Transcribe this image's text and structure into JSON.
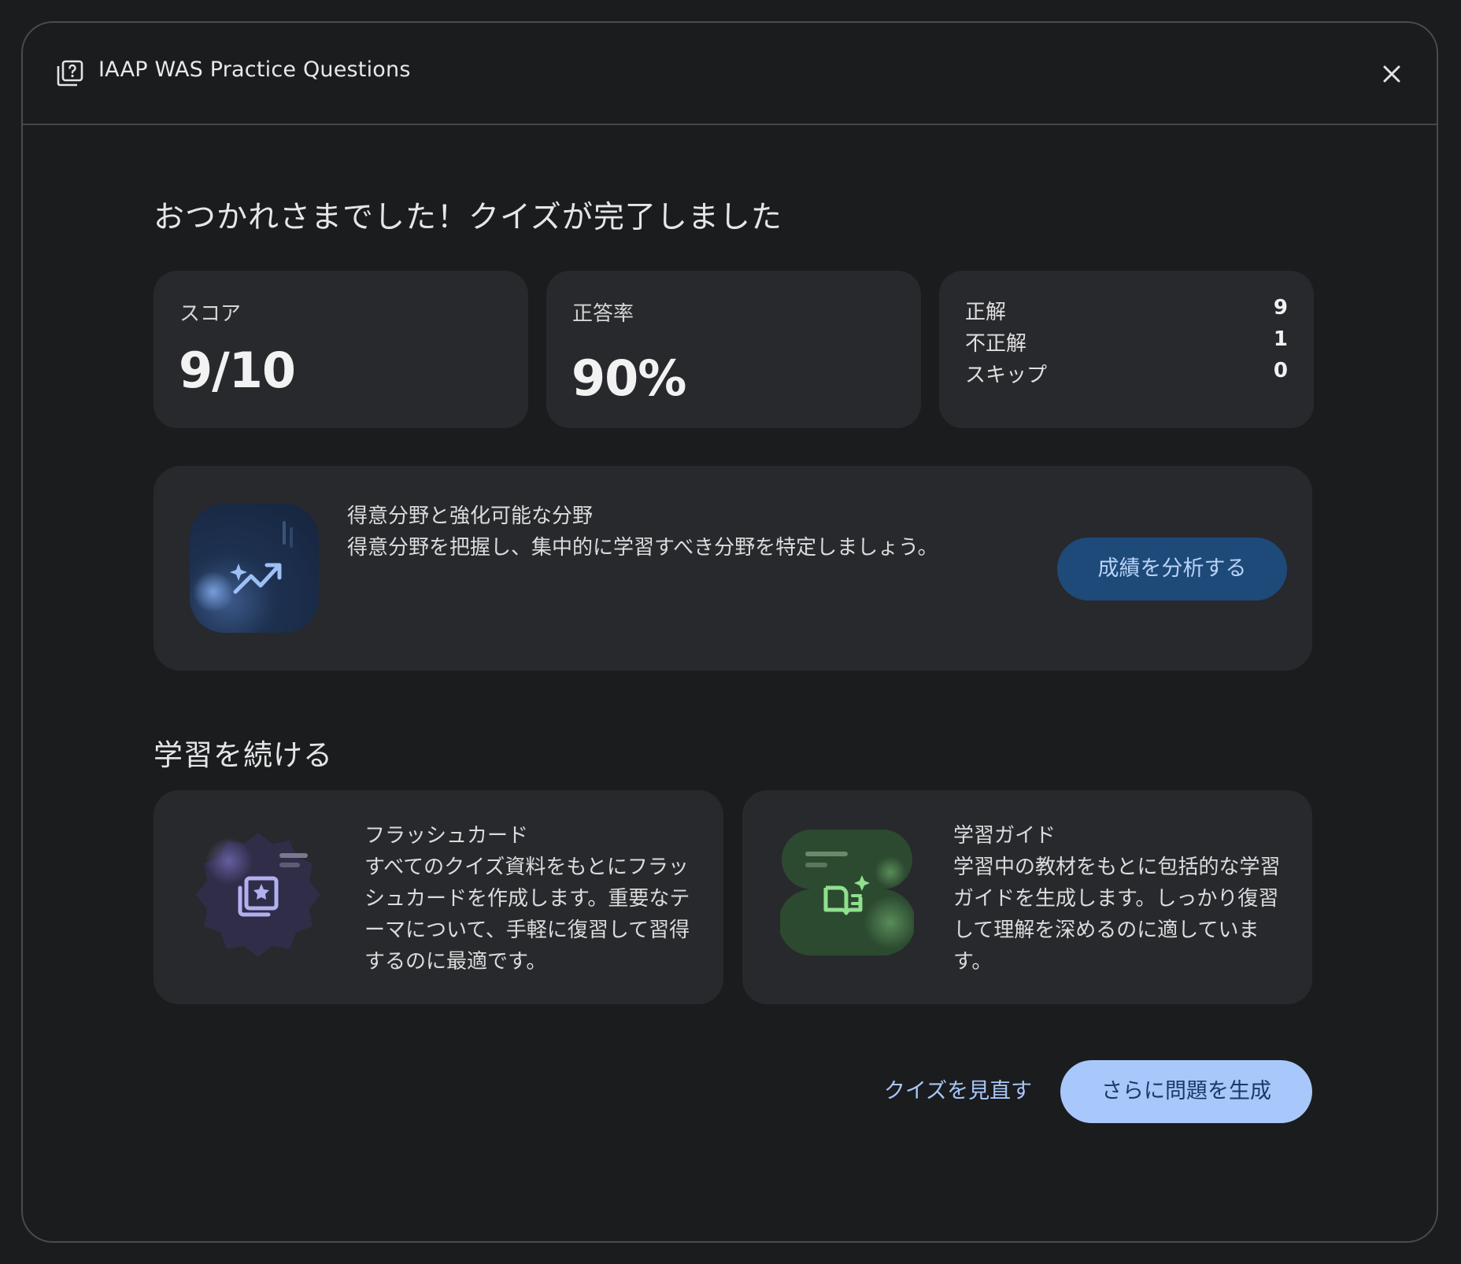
{
  "header": {
    "title": "IAAP WAS Practice Questions",
    "doc_icon": "quiz-doc-icon",
    "close_icon": "close-icon"
  },
  "heading": "おつかれさまでした！クイズが完了しました",
  "stats": {
    "score_label": "スコア",
    "score_value": "9/10",
    "accuracy_label": "正答率",
    "accuracy_value": "90%",
    "breakdown": [
      {
        "label": "正解",
        "value": "9"
      },
      {
        "label": "不正解",
        "value": "1"
      },
      {
        "label": "スキップ",
        "value": "0"
      }
    ]
  },
  "analysis": {
    "title": "得意分野と強化可能な分野",
    "description": "得意分野を把握し、集中的に学習すべき分野を特定しましょう。",
    "button_label": "成績を分析する",
    "icon": "trending-up-sparkle-icon"
  },
  "continue_heading": "学習を続ける",
  "options": [
    {
      "title": "フラッシュカード",
      "description": "すべてのクイズ資料をもとにフラッシュカードを作成します。重要なテーマについて、手軽に復習して習得するのに最適です。",
      "icon": "flashcards-icon"
    },
    {
      "title": "学習ガイド",
      "description": "学習中の教材をもとに包括的な学習ガイドを生成します。しっかり復習して理解を深めるのに適しています。",
      "icon": "study-guide-icon"
    }
  ],
  "footer": {
    "review_label": "クイズを見直す",
    "more_label": "さらに問題を生成"
  },
  "colors": {
    "background": "#1b1c1e",
    "card": "#28292d",
    "accent": "#a8c7fa",
    "analyze_button": "#1e4a7a"
  }
}
